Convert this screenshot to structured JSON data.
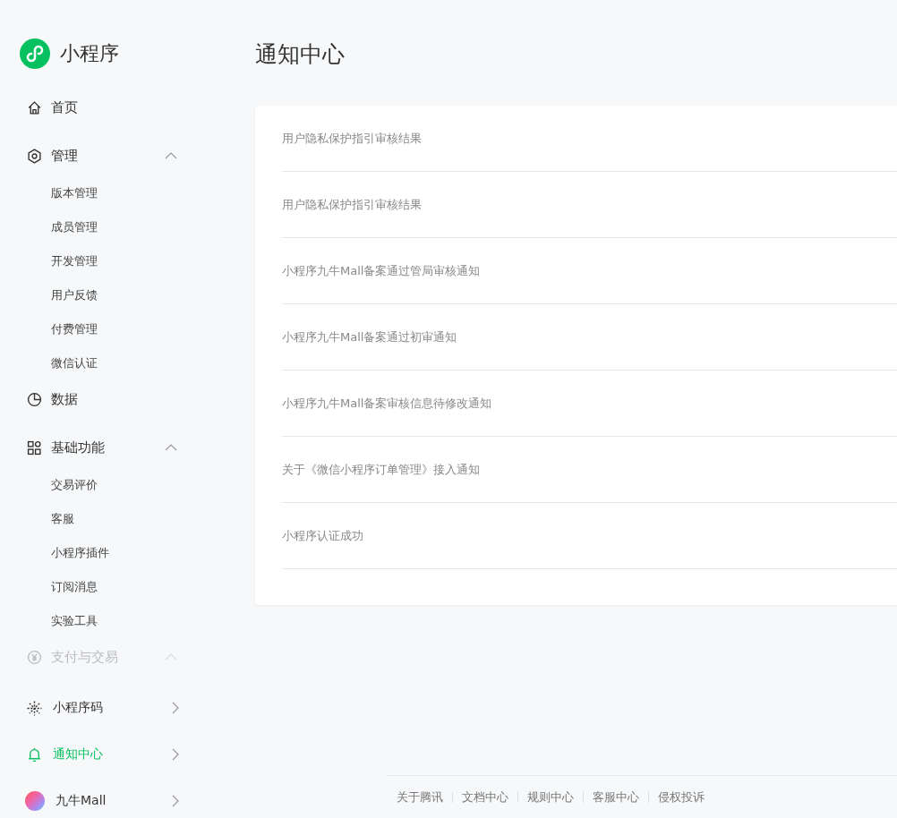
{
  "sidebar": {
    "brand": "小程序",
    "items": [
      {
        "kind": "link",
        "label": "首页",
        "selected": false
      },
      {
        "kind": "group",
        "label": "管理",
        "expanded": true,
        "disabled": false,
        "children": [
          {
            "label": "版本管理",
            "selected": false
          },
          {
            "label": "成员管理",
            "selected": false
          },
          {
            "label": "开发管理",
            "selected": false
          },
          {
            "label": "用户反馈",
            "selected": false
          },
          {
            "label": "付费管理",
            "selected": false
          },
          {
            "label": "微信认证",
            "selected": false
          }
        ]
      },
      {
        "kind": "link",
        "label": "数据",
        "selected": false
      },
      {
        "kind": "group",
        "label": "基础功能",
        "expanded": true,
        "disabled": false,
        "children": [
          {
            "label": "交易评价",
            "selected": false
          },
          {
            "label": "客服",
            "selected": false
          },
          {
            "label": "小程序插件",
            "selected": false
          },
          {
            "label": "订阅消息",
            "selected": false
          },
          {
            "label": "实验工具",
            "selected": false
          }
        ]
      },
      {
        "kind": "group",
        "label": "支付与交易",
        "expanded": true,
        "disabled": true
      },
      {
        "kind": "section",
        "label": "小程序码",
        "selected": false
      },
      {
        "kind": "section",
        "label": "通知中心",
        "selected": true
      },
      {
        "kind": "section",
        "label": "九牛Mall",
        "selected": false
      }
    ]
  },
  "page": {
    "title": "通知中心"
  },
  "notifications": [
    {
      "title": "用户隐私保护指引审核结果"
    },
    {
      "title": "用户隐私保护指引审核结果"
    },
    {
      "title": "小程序九牛Mall备案通过管局审核通知"
    },
    {
      "title": "小程序九牛Mall备案通过初审通知"
    },
    {
      "title": "小程序九牛Mall备案审核信息待修改通知"
    },
    {
      "title": "关于《微信小程序订单管理》接入通知"
    },
    {
      "title": "小程序认证成功"
    }
  ],
  "footer": {
    "links": [
      "关于腾讯",
      "文档中心",
      "规则中心",
      "客服中心",
      "侵权投诉"
    ]
  }
}
